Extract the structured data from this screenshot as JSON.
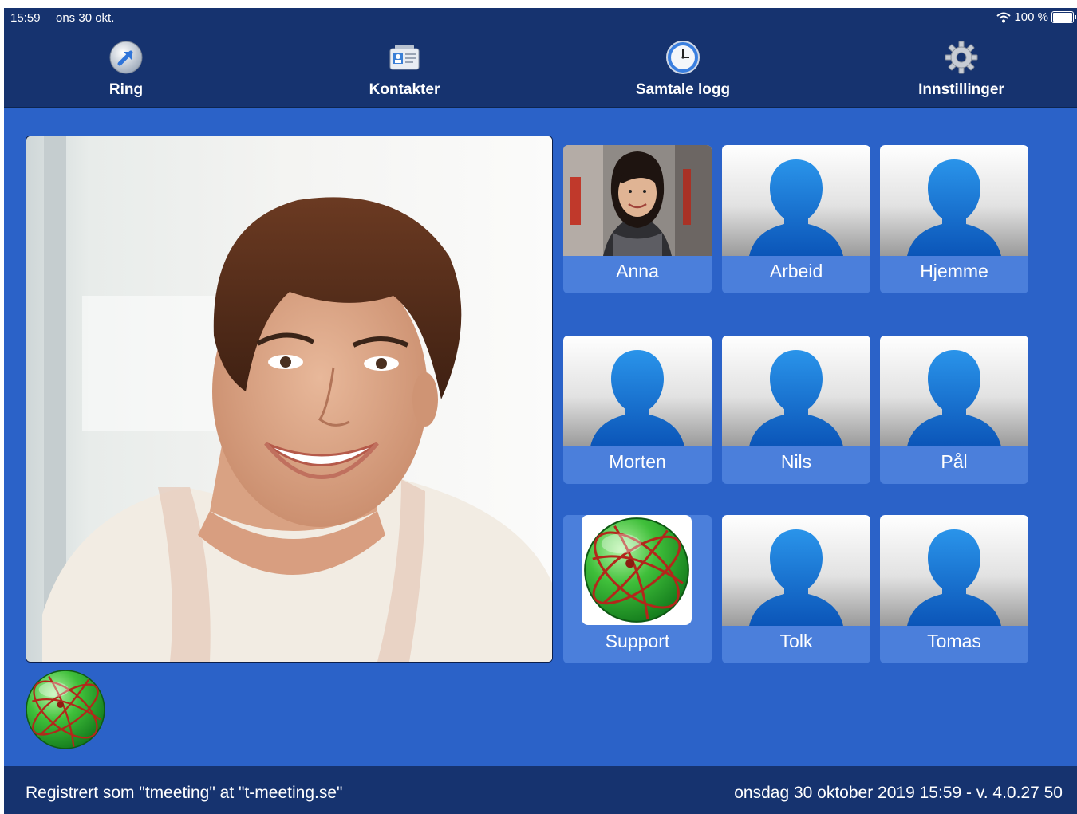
{
  "status": {
    "time": "15:59",
    "date": "ons 30 okt.",
    "battery": "100 %"
  },
  "nav": [
    {
      "label": "Ring",
      "icon": "ring-arrow-icon"
    },
    {
      "label": "Kontakter",
      "icon": "contact-card-icon"
    },
    {
      "label": "Samtale logg",
      "icon": "clock-icon"
    },
    {
      "label": "Innstillinger",
      "icon": "gear-icon"
    }
  ],
  "contacts": [
    {
      "label": "Anna",
      "type": "photo"
    },
    {
      "label": "Arbeid",
      "type": "silhouette"
    },
    {
      "label": "Hjemme",
      "type": "silhouette"
    },
    {
      "label": "Morten",
      "type": "silhouette"
    },
    {
      "label": "Nils",
      "type": "silhouette"
    },
    {
      "label": "Pål",
      "type": "silhouette"
    },
    {
      "label": "Support",
      "type": "globe"
    },
    {
      "label": "Tolk",
      "type": "silhouette"
    },
    {
      "label": "Tomas",
      "type": "silhouette"
    }
  ],
  "footer": {
    "registered": "Registrert som \"tmeeting\" at \"t-meeting.se\"",
    "datetime_version": "onsdag 30 oktober 2019 15:59 - v. 4.0.27 50"
  },
  "colors": {
    "background": "#2b62c8",
    "bar": "#16336f",
    "tile": "#4b7fdb",
    "silhouette": "#1b76d6"
  }
}
